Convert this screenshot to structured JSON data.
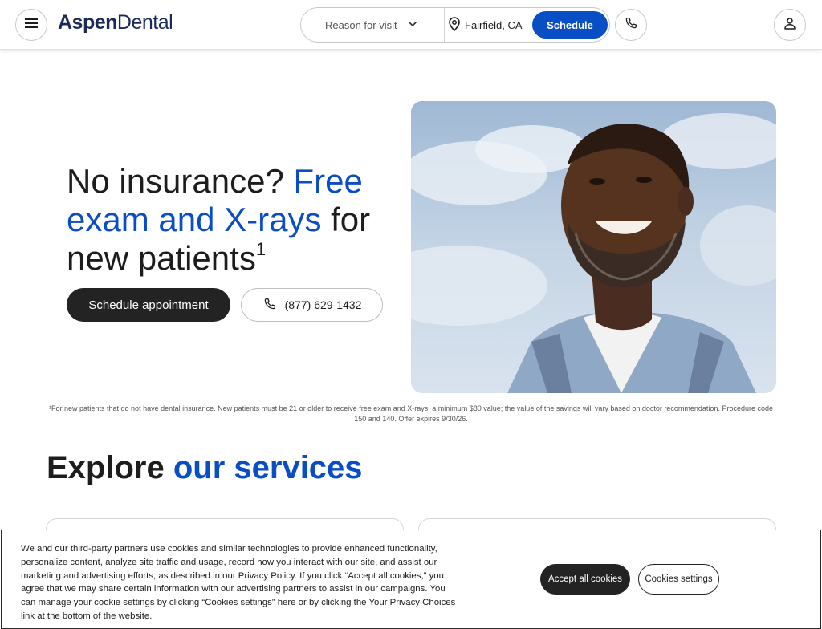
{
  "header": {
    "menu_icon": "hamburger-menu-icon",
    "logo": {
      "part1": "Aspen",
      "part2": "Dental"
    },
    "search": {
      "reason_label": "Reason for visit",
      "location": "Fairfield, CA",
      "schedule_label": "Schedule"
    },
    "phone_icon": "phone-icon",
    "account_icon": "person-icon"
  },
  "hero": {
    "title_part1": "No insurance? ",
    "title_highlight": "Free exam and X-rays",
    "title_part2": " for new patients",
    "title_sup": "1",
    "primary_cta": "Schedule appointment",
    "phone_cta": "(877) 629-1432",
    "image_alt_subject": "Smiling man with beard in plaid shirt against sky",
    "brand_color": "#0a4ec6"
  },
  "disclaimer": "¹For new patients that do not have dental insurance. New patients must be 21 or older to receive free exam and X-rays, a minimum $80 value; the value of the savings will vary based on doctor recommendation. Procedure code 150 and 140. Offer expires 9/30/26.",
  "services": {
    "heading_part1": "Explore ",
    "heading_highlight": "our services"
  },
  "cookie_banner": {
    "text": "We and our third-party partners use cookies and similar technologies to provide enhanced functionality, personalize content, analyze site traffic and usage, record how you interact with our site, and assist our marketing and advertising efforts, as described in our Privacy Policy. If you click “Accept all cookies,” you agree that we may share certain information with our advertising partners to assist in our campaigns. You can manage your cookie settings by clicking “Cookies settings” here or by clicking the Your Privacy Choices link at the bottom of the website.",
    "accept_label": "Accept all cookies",
    "settings_label": "Cookies settings"
  }
}
